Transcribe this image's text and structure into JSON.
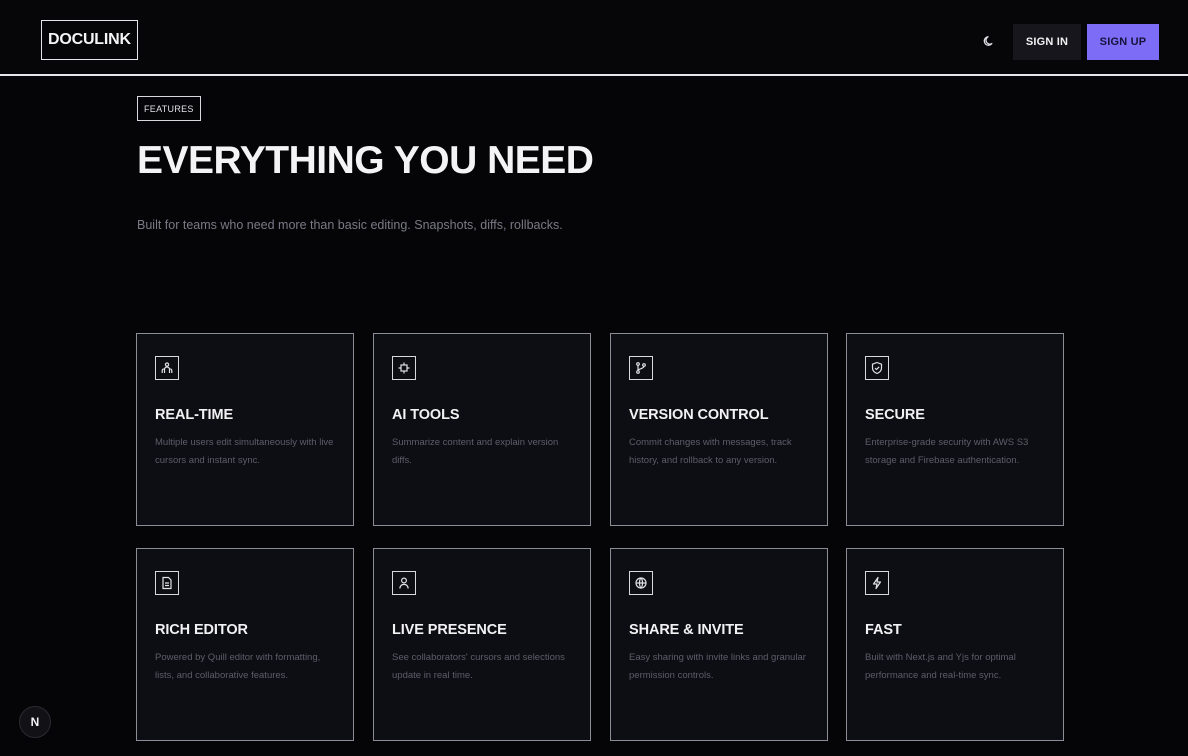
{
  "header": {
    "logo": "DOCULINK",
    "theme_icon": "moon-icon",
    "sign_in": "SIGN IN",
    "sign_up": "SIGN UP",
    "accent_color": "#7c6cf6"
  },
  "hero": {
    "badge": "FEATURES",
    "title": "EVERYTHING YOU NEED",
    "subtitle": "Built for teams who need more than basic editing. Snapshots, diffs, rollbacks."
  },
  "features": [
    {
      "icon": "users-icon",
      "title": "REAL-TIME",
      "description": "Multiple users edit simultaneously with live cursors and instant sync."
    },
    {
      "icon": "ai-sparkle-icon",
      "title": "AI TOOLS",
      "description": "Summarize content and explain version diffs."
    },
    {
      "icon": "git-branch-icon",
      "title": "VERSION CONTROL",
      "description": "Commit changes with messages, track history, and rollback to any version."
    },
    {
      "icon": "shield-check-icon",
      "title": "SECURE",
      "description": "Enterprise-grade security with AWS S3 storage and Firebase authentication."
    },
    {
      "icon": "document-icon",
      "title": "RICH EDITOR",
      "description": "Powered by Quill editor with formatting, lists, and collaborative features."
    },
    {
      "icon": "user-icon",
      "title": "LIVE PRESENCE",
      "description": "See collaborators' cursors and selections update in real time."
    },
    {
      "icon": "globe-icon",
      "title": "SHARE & INVITE",
      "description": "Easy sharing with invite links and granular permission controls."
    },
    {
      "icon": "lightning-icon",
      "title": "FAST",
      "description": "Built with Next.js and Yjs for optimal performance and real-time sync."
    }
  ],
  "floating_badge": "N"
}
